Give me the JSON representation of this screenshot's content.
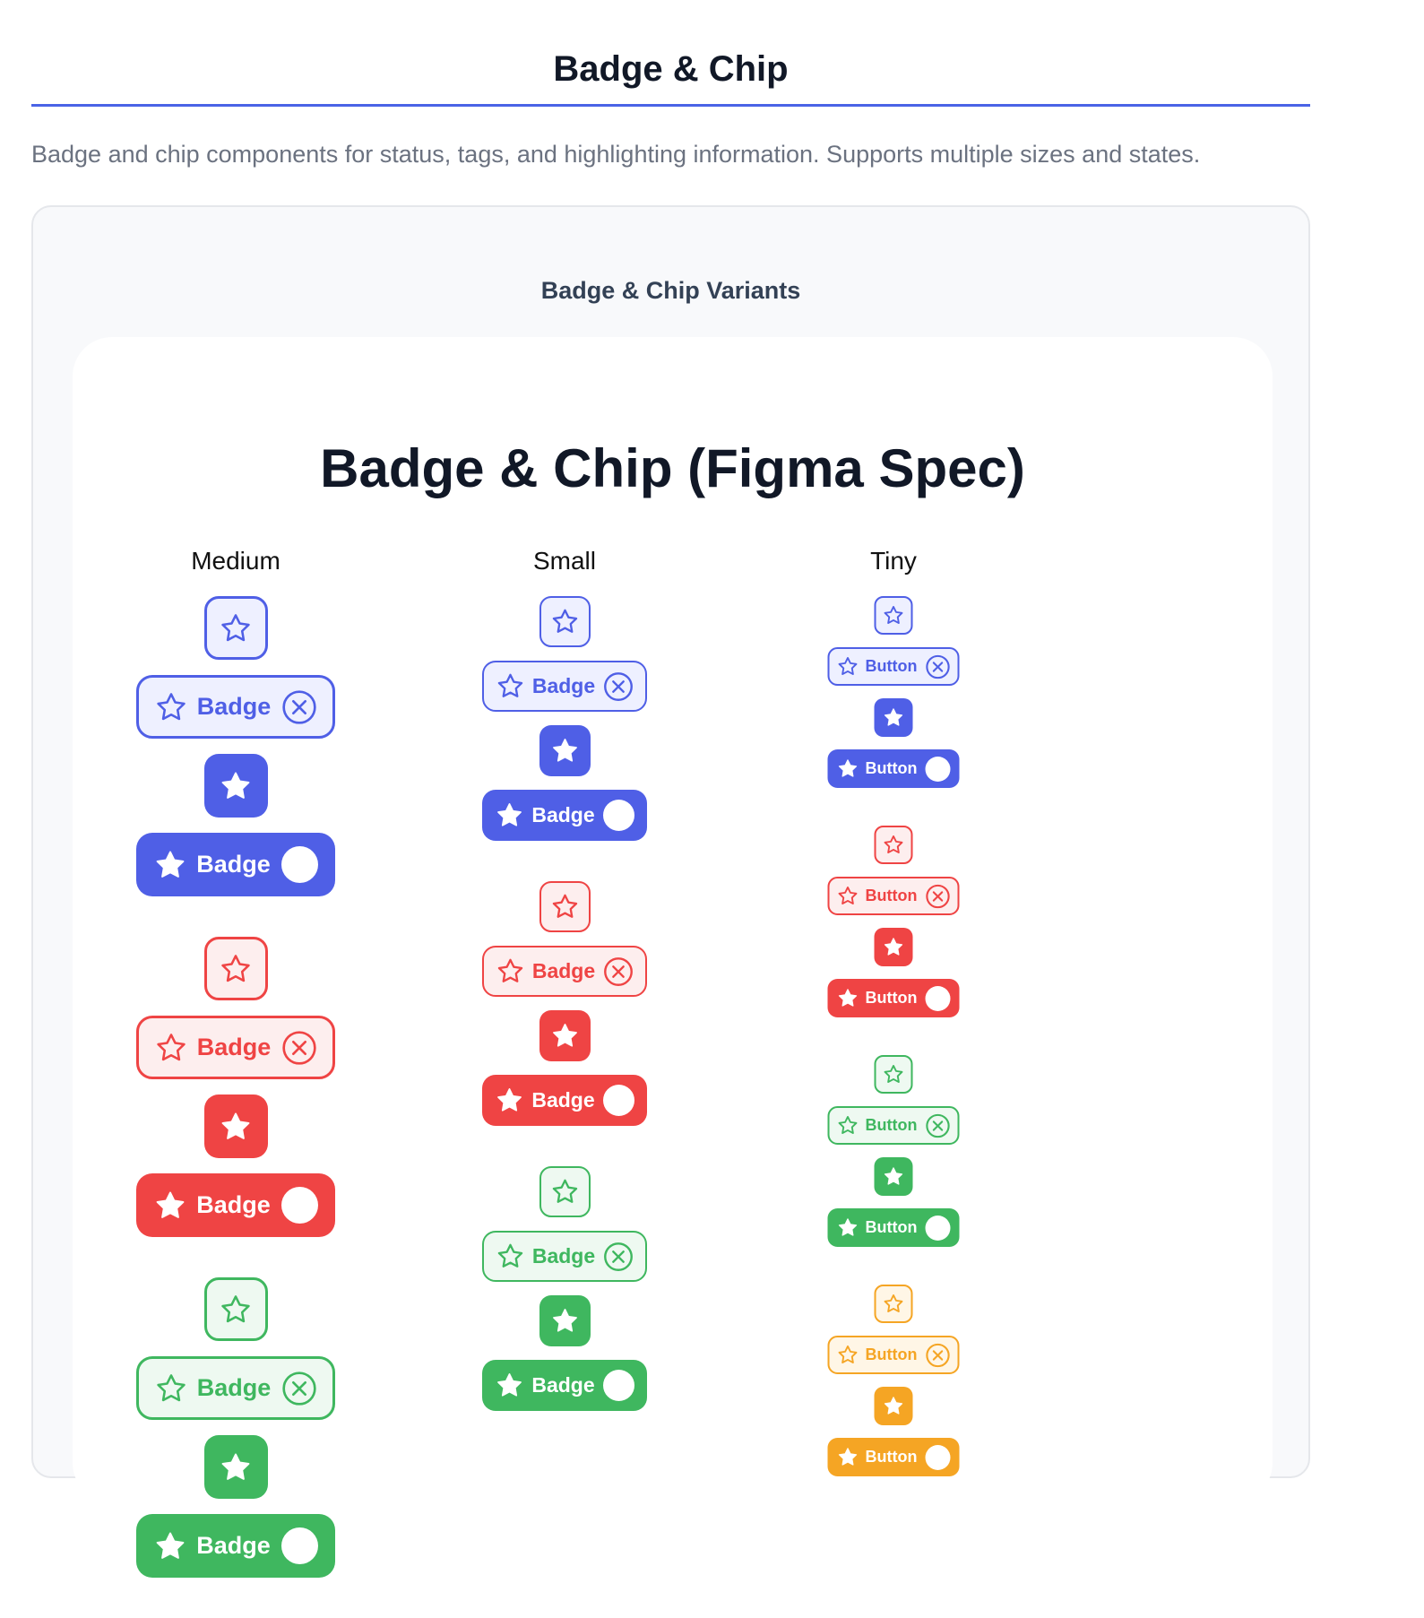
{
  "page": {
    "title": "Badge & Chip",
    "description": "Badge and chip components for status, tags, and highlighting information. Supports multiple sizes and states."
  },
  "demo": {
    "label": "Badge & Chip Variants",
    "spec_title": "Badge & Chip (Figma Spec)"
  },
  "icons": {
    "leading": "star-icon",
    "remove": "close-circle-icon",
    "toggle": "dot-toggle"
  },
  "colors": {
    "blue": "#4f5fe6",
    "blue_tint": "#eef0ff",
    "red": "#ef4444",
    "red_tint": "#fdeeee",
    "green": "#3fb75f",
    "green_tint": "#eef9f1",
    "orange": "#f5a524",
    "orange_tint": "#fff6e6"
  },
  "columns": [
    {
      "header": "Medium",
      "size": "m",
      "groups": [
        {
          "color": "blue",
          "outline_label": "Badge",
          "solid_label": "Badge"
        },
        {
          "color": "red",
          "outline_label": "Badge",
          "solid_label": "Badge"
        },
        {
          "color": "green",
          "outline_label": "Badge",
          "solid_label": "Badge"
        }
      ]
    },
    {
      "header": "Small",
      "size": "s",
      "groups": [
        {
          "color": "blue",
          "outline_label": "Badge",
          "solid_label": "Badge"
        },
        {
          "color": "red",
          "outline_label": "Badge",
          "solid_label": "Badge"
        },
        {
          "color": "green",
          "outline_label": "Badge",
          "solid_label": "Badge"
        }
      ]
    },
    {
      "header": "Tiny",
      "size": "t",
      "groups": [
        {
          "color": "blue",
          "outline_label": "Button",
          "solid_label": "Button"
        },
        {
          "color": "red",
          "outline_label": "Button",
          "solid_label": "Button"
        },
        {
          "color": "green",
          "outline_label": "Button",
          "solid_label": "Button"
        },
        {
          "color": "orange",
          "outline_label": "Button",
          "solid_label": "Button"
        }
      ]
    }
  ]
}
